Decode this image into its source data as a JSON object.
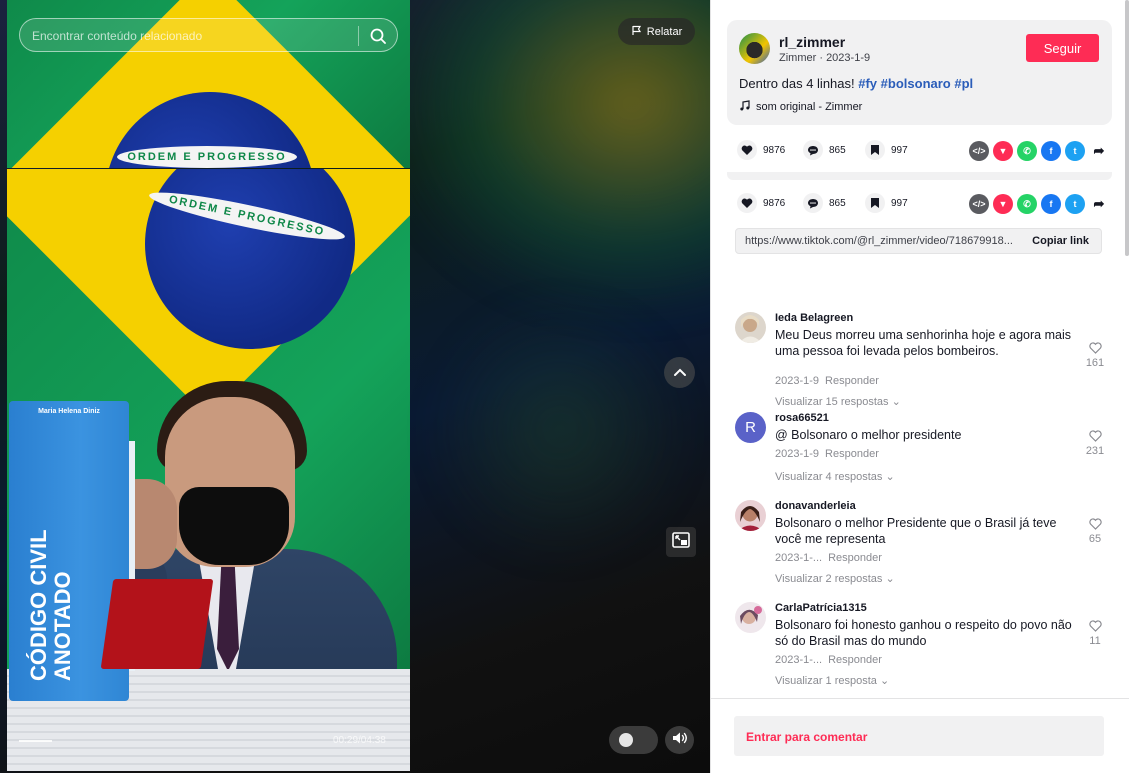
{
  "search": {
    "placeholder": "Encontrar conteúdo relacionado"
  },
  "video": {
    "report_label": "Relatar",
    "time": "00:29/04:38",
    "progress_fraction": 0.104,
    "book": {
      "author": "Maria Helena Diniz",
      "title": "CÓDIGO CIVIL ANOTADO"
    },
    "flag_motto": "ORDEM E PROGRESSO"
  },
  "author": {
    "username": "rl_zimmer",
    "display_name": "Zimmer",
    "date": "2023-1-9",
    "separator": " · ",
    "follow_label": "Seguir"
  },
  "post": {
    "description": "Dentro das 4 linhas!",
    "hashtags": [
      "#fy",
      "#bolsonaro",
      "#pl"
    ],
    "music": "som original - Zimmer"
  },
  "stats": {
    "likes": "9876",
    "comments": "865",
    "saves": "997"
  },
  "share": {
    "link": "https://www.tiktok.com/@rl_zimmer/video/718679918...",
    "copy_label": "Copiar link",
    "icons": [
      "embed-icon",
      "send-icon",
      "whatsapp-icon",
      "facebook-icon",
      "twitter-icon",
      "forward-icon"
    ]
  },
  "comments": [
    {
      "user": "Ieda Belagreen",
      "text": "Meu Deus morreu uma senhorinha hoje e agora mais uma pessoa foi levada pelos bombeiros.",
      "date": "2023-1-9",
      "reply": "Responder",
      "replies": "Visualizar 15 respostas",
      "likes": "161"
    },
    {
      "user": "rosa66521",
      "avatar_letter": "R",
      "text": "@ Bolsonaro o melhor presidente",
      "date": "2023-1-9",
      "reply": "Responder",
      "replies": "Visualizar 4 respostas",
      "likes": "231"
    },
    {
      "user": "donavanderleia",
      "text": "Bolsonaro o melhor Presidente que o Brasil já teve você me representa",
      "date": "2023-1-...",
      "reply": "Responder",
      "replies": "Visualizar 2 respostas",
      "likes": "65"
    },
    {
      "user": "CarlaPatrícia1315",
      "text": "Bolsonaro foi honesto ganhou o respeito do povo não só do Brasil mas do mundo",
      "date": "2023-1-...",
      "reply": "Responder",
      "replies": "Visualizar 1 resposta",
      "likes": "11"
    }
  ],
  "comment_box": {
    "login_prompt": "Entrar para comentar"
  },
  "colors": {
    "accent": "#fe2c55",
    "hashtag": "#2b5db9",
    "muted": "#8a8b91"
  }
}
